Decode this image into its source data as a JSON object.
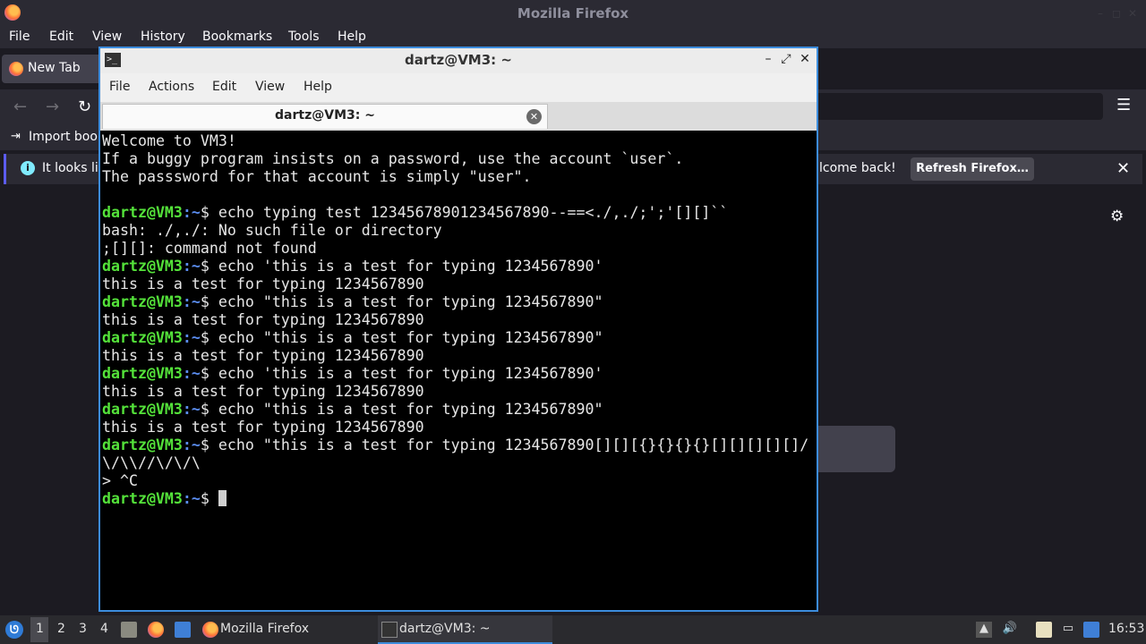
{
  "firefox": {
    "window_title": "Mozilla Firefox",
    "menu": [
      "File",
      "Edit",
      "View",
      "History",
      "Bookmarks",
      "Tools",
      "Help"
    ],
    "tab_label": "New Tab",
    "bookmarks_text": "Import book",
    "notice_left": "It looks lik",
    "notice_right": "lcome back!",
    "refresh_button": "Refresh Firefox…"
  },
  "terminal": {
    "window_title": "dartz@VM3: ~",
    "menu": [
      "File",
      "Actions",
      "Edit",
      "View",
      "Help"
    ],
    "tab_label": "dartz@VM3: ~",
    "prompt_user": "dartz@VM3",
    "prompt_path": ":~",
    "prompt_sym": "$ ",
    "lines": [
      {
        "text": "Welcome to VM3!"
      },
      {
        "text": "If a buggy program insists on a password, use the account `user`."
      },
      {
        "text": "The passsword for that account is simply \"user\"."
      },
      {
        "text": ""
      },
      {
        "cmd": "echo typing test 12345678901234567890--==<./,./;';'[][]``"
      },
      {
        "text": "bash: ./,./: No such file or directory"
      },
      {
        "text": ";[][]: command not found"
      },
      {
        "cmd": "echo 'this is a test for typing 1234567890'"
      },
      {
        "text": "this is a test for typing 1234567890"
      },
      {
        "cmd": "echo \"this is a test for typing 1234567890\""
      },
      {
        "text": "this is a test for typing 1234567890"
      },
      {
        "cmd": "echo \"this is a test for typing 1234567890\""
      },
      {
        "text": "this is a test for typing 1234567890"
      },
      {
        "cmd": "echo 'this is a test for typing 1234567890'"
      },
      {
        "text": "this is a test for typing 1234567890"
      },
      {
        "cmd": "echo \"this is a test for typing 1234567890\""
      },
      {
        "text": "this is a test for typing 1234567890"
      },
      {
        "cmd": "echo \"this is a test for typing 1234567890[][][{}{}{}{}[][][][][]/"
      },
      {
        "text": "\\/\\\\//\\/\\/\\"
      },
      {
        "text": "> ^C"
      },
      {
        "cmd": "",
        "cursor": true
      }
    ]
  },
  "taskbar": {
    "workspaces": [
      "1",
      "2",
      "3",
      "4"
    ],
    "active_workspace": "1",
    "tasks": [
      {
        "label": "Mozilla Firefox"
      },
      {
        "label": "dartz@VM3: ~"
      }
    ],
    "clock": "16:53"
  }
}
